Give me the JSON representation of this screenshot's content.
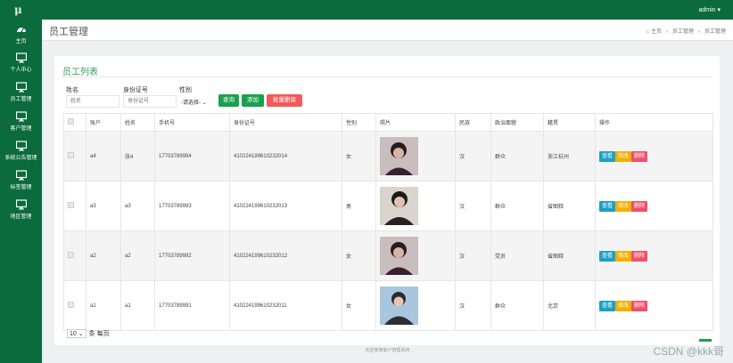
{
  "topbar": {
    "logo": "μ",
    "user": "admin ▾"
  },
  "sidebar": [
    {
      "label": "主页",
      "icon": "dashboard-icon"
    },
    {
      "label": "个人中心",
      "icon": "monitor-icon"
    },
    {
      "label": "员工管理",
      "icon": "monitor-icon"
    },
    {
      "label": "客户管理",
      "icon": "monitor-icon"
    },
    {
      "label": "系统公告管理",
      "icon": "monitor-icon"
    },
    {
      "label": "标签管理",
      "icon": "monitor-icon"
    },
    {
      "label": "地区管理",
      "icon": "monitor-icon"
    }
  ],
  "header": {
    "title": "员工管理",
    "crumb_home": "主页",
    "crumb_1": "员工管理",
    "crumb_2": "员工管理"
  },
  "card": {
    "title": "员工列表"
  },
  "filters": {
    "name_label": "姓名",
    "name_placeholder": "姓名",
    "id_label": "身份证号",
    "id_placeholder": "身份证号",
    "gender_label": "性别",
    "gender_selected": "-请选择-",
    "search": "查询",
    "add": "添加",
    "batch_delete": "批量删除"
  },
  "table": {
    "headers": [
      "账户",
      "姓名",
      "手机号",
      "身份证号",
      "性别",
      "照片",
      "民族",
      "政治面貌",
      "籍贯",
      "操作"
    ],
    "actions": {
      "view": "查看",
      "edit": "修改",
      "delete": "删除"
    },
    "rows": [
      {
        "account": "a4",
        "name": "张4",
        "phone": "17703789994",
        "id_card": "410224199610232014",
        "gender": "女",
        "ethnic": "汉",
        "political": "群众",
        "native": "浙江杭州"
      },
      {
        "account": "a3",
        "name": "a3",
        "phone": "17703789993",
        "id_card": "410224199610232013",
        "gender": "男",
        "ethnic": "汉",
        "political": "群众",
        "native": "省图释"
      },
      {
        "account": "a2",
        "name": "a2",
        "phone": "17703789992",
        "id_card": "410224199610232012",
        "gender": "女",
        "ethnic": "汉",
        "political": "党员",
        "native": "省图释"
      },
      {
        "account": "a1",
        "name": "a1",
        "phone": "17703789991",
        "id_card": "410224199610232011",
        "gender": "女",
        "ethnic": "汉",
        "political": "群众",
        "native": "北京"
      }
    ]
  },
  "pager": {
    "page_size": "10",
    "suffix": "条 每页"
  },
  "footer": {
    "text": "欢迎使用客户管理系统"
  },
  "watermark": "CSDN @kkk哥"
}
